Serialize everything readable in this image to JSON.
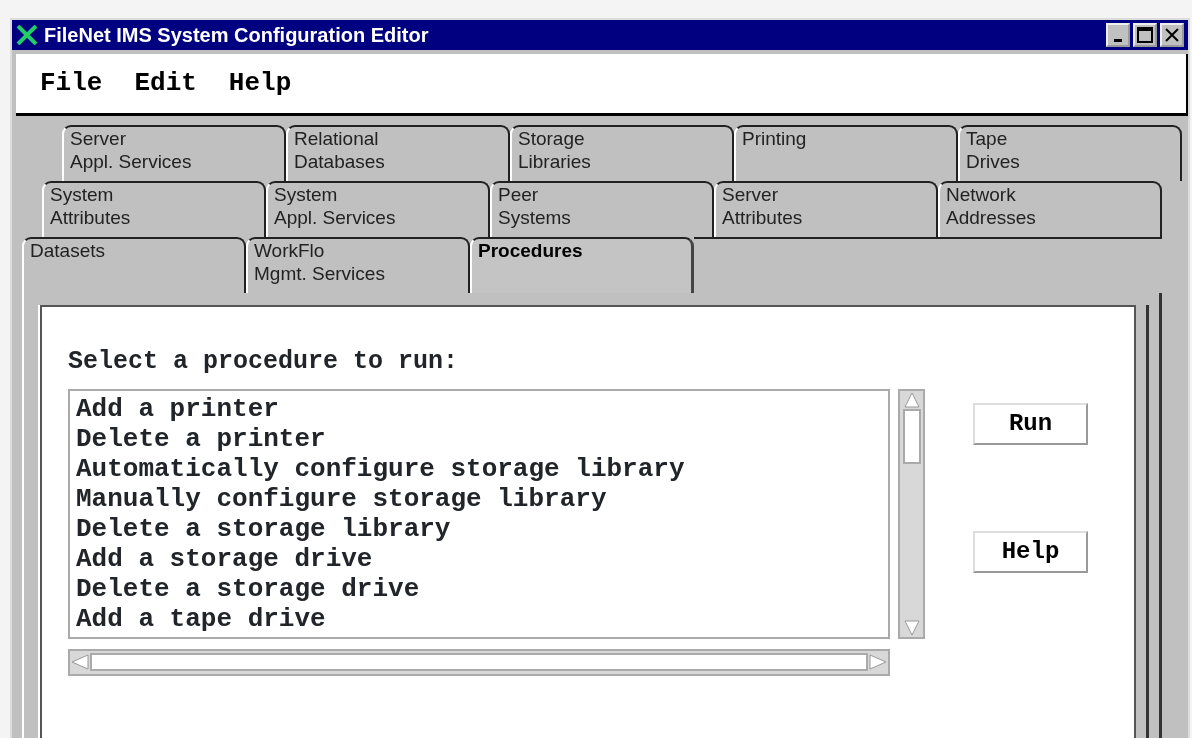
{
  "window": {
    "title": "FileNet IMS System Configuration Editor"
  },
  "menu": [
    {
      "label": "File"
    },
    {
      "label": "Edit"
    },
    {
      "label": "Help"
    }
  ],
  "tab_rows": [
    [
      {
        "lines": [
          "Server",
          "Appl. Services"
        ],
        "selected": false
      },
      {
        "lines": [
          "Relational",
          "Databases"
        ],
        "selected": false
      },
      {
        "lines": [
          "Storage",
          "Libraries"
        ],
        "selected": false
      },
      {
        "lines": [
          "Printing"
        ],
        "selected": false
      },
      {
        "lines": [
          "Tape",
          "Drives"
        ],
        "selected": false
      }
    ],
    [
      {
        "lines": [
          "System",
          "Attributes"
        ],
        "selected": false
      },
      {
        "lines": [
          "System",
          "Appl. Services"
        ],
        "selected": false
      },
      {
        "lines": [
          "Peer",
          "Systems"
        ],
        "selected": false
      },
      {
        "lines": [
          "Server",
          "Attributes"
        ],
        "selected": false
      },
      {
        "lines": [
          "Network",
          "Addresses"
        ],
        "selected": false
      }
    ],
    [
      {
        "lines": [
          "Datasets"
        ],
        "selected": false
      },
      {
        "lines": [
          "WorkFlo",
          "Mgmt. Services"
        ],
        "selected": false
      },
      {
        "lines": [
          "Procedures"
        ],
        "selected": true
      }
    ]
  ],
  "prompt": "Select a procedure to run:",
  "procedures": [
    "Add a printer",
    "Delete a printer",
    "Automatically configure storage library",
    "Manually configure storage library",
    "Delete a storage library",
    "Add a storage drive",
    "Delete a storage drive",
    "Add a tape drive"
  ],
  "buttons": [
    {
      "label": "Run"
    },
    {
      "label": "Help"
    }
  ]
}
